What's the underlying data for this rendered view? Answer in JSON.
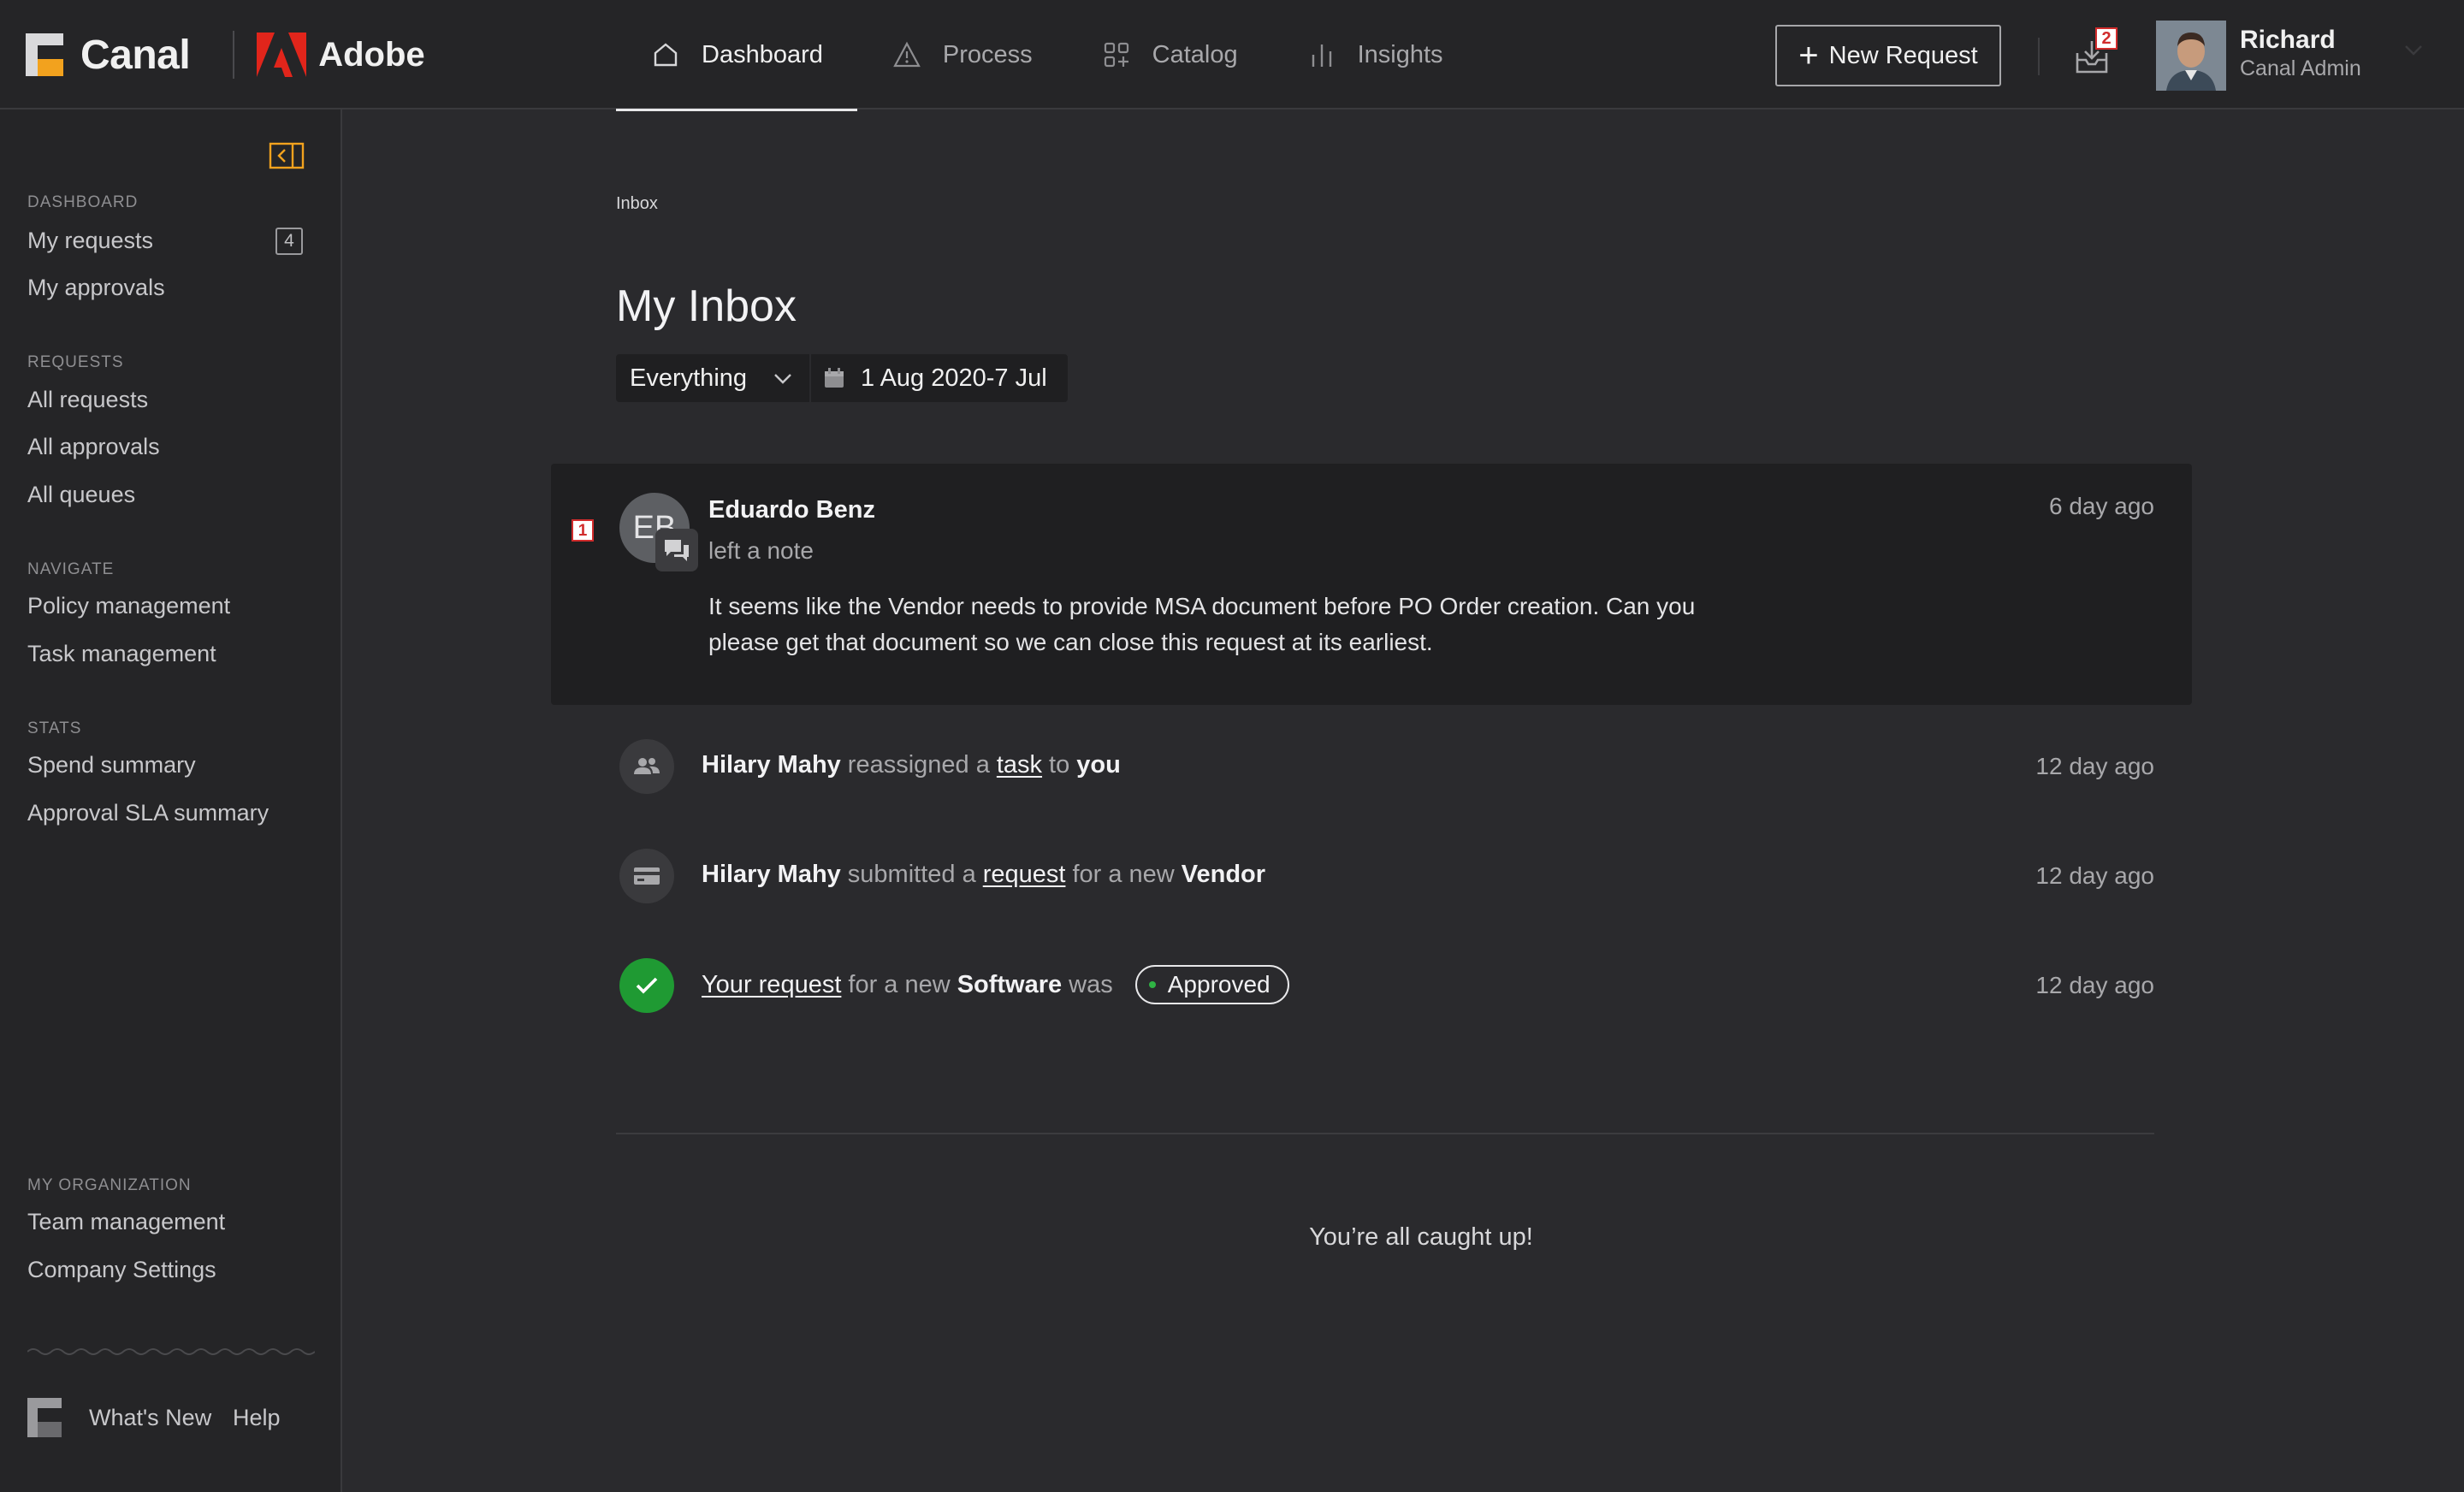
{
  "brand": {
    "name": "Canal",
    "partner": "Adobe"
  },
  "nav": {
    "items": [
      {
        "label": "Dashboard",
        "icon": "home-icon",
        "active": true
      },
      {
        "label": "Process",
        "icon": "warning-triangle-icon",
        "active": false
      },
      {
        "label": "Catalog",
        "icon": "grid-plus-icon",
        "active": false
      },
      {
        "label": "Insights",
        "icon": "bar-chart-icon",
        "active": false
      }
    ]
  },
  "header": {
    "new_request_label": "New Request",
    "inbox_badge": "2",
    "user_name": "Richard",
    "user_role": "Canal Admin"
  },
  "sidebar": {
    "dashboard_section": "DASHBOARD",
    "my_requests": "My requests",
    "my_requests_count": "4",
    "my_approvals": "My approvals",
    "requests_section": "REQUESTS",
    "all_requests": "All requests",
    "all_approvals": "All approvals",
    "all_queues": "All queues",
    "navigate_section": "NAVIGATE",
    "policy_management": "Policy management",
    "task_management": "Task management",
    "stats_section": "STATS",
    "spend_summary": "Spend summary",
    "approval_sla_summary": "Approval SLA summary",
    "org_section": "MY ORGANIZATION",
    "team_management": "Team management",
    "company_settings": "Company Settings",
    "whats_new": "What's New",
    "help": "Help"
  },
  "main": {
    "breadcrumb": "Inbox",
    "title": "My Inbox",
    "filter_value": "Everything",
    "date_range": "1 Aug 2020-7 Jul"
  },
  "feed": {
    "note": {
      "badge": "1",
      "initials": "EB",
      "actor": "Eduardo Benz",
      "action": "left a note",
      "body": "It seems like the Vendor needs to provide MSA document before PO Order creation. Can you please get that document so we can close this request at its earliest.",
      "time": "6 day ago"
    },
    "activity1": {
      "actor": "Hilary Mahy",
      "t1": "reassigned a",
      "link": "task",
      "t2": "to",
      "target": "you",
      "time": "12 day ago"
    },
    "activity2": {
      "actor": "Hilary Mahy",
      "t1": "submitted a",
      "link": "request",
      "t2": "for a new",
      "target": "Vendor",
      "time": "12 day ago"
    },
    "activity3": {
      "link": "Your request",
      "t1": "for a new",
      "target": "Software",
      "t2": "was",
      "status": "Approved",
      "time": "12 day ago"
    },
    "caught_up": "You’re all caught up!"
  },
  "colors": {
    "accent": "#f2a21e",
    "approved": "#2fb344",
    "badge": "#d12c2c",
    "adobe": "#e1251b"
  }
}
